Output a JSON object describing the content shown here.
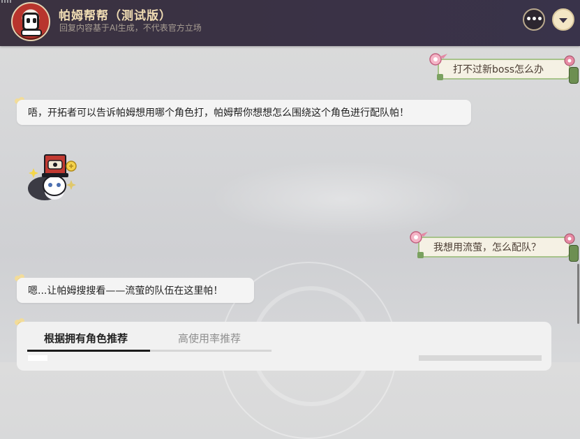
{
  "header": {
    "title": "帕姆帮帮（测试版）",
    "subtitle": "回复内容基于AI生成，不代表官方立场",
    "more_icon": "more-icon",
    "collapse_icon": "chevron-down-icon"
  },
  "messages": [
    {
      "role": "user",
      "text": "打不过新boss怎么办"
    },
    {
      "role": "assistant",
      "text": "唔，开拓者可以告诉帕姆想用哪个角色打，帕姆帮你想想怎么围绕这个角色进行配队帕！"
    },
    {
      "role": "assistant",
      "type": "sticker",
      "icon": "pom-pom-sticker-icon"
    },
    {
      "role": "user",
      "text": "我想用流萤，怎么配队？"
    },
    {
      "role": "assistant",
      "text": "嗯...让帕姆搜搜看——流萤的队伍在这里帕！"
    }
  ],
  "recommend_card": {
    "tabs": [
      {
        "label": "根据拥有角色推荐",
        "active": true
      },
      {
        "label": "高使用率推荐",
        "active": false
      }
    ]
  },
  "colors": {
    "header_bg": "#3a3245",
    "title_gold": "#f0dcb3",
    "user_bubble_border": "#a7c38a",
    "user_bubble_bg": "#f5f1e4"
  }
}
